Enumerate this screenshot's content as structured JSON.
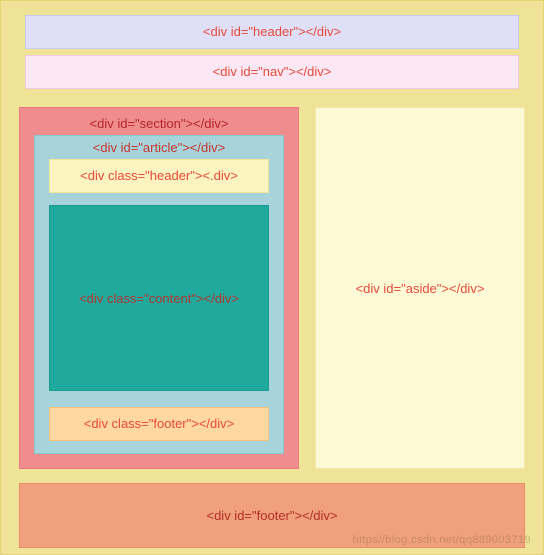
{
  "top": {
    "header_label": "<div id=\"header\"></div>",
    "nav_label": "<div id=\"nav\"></div>"
  },
  "section": {
    "label": "<div id=\"section\"></div>",
    "article": {
      "label": "<div id=\"article\"></div>",
      "header_label": "<div class=\"header\"><.div>",
      "content_label": "<div class=\"content\"></div>",
      "footer_label": "<div class=\"footer\"></div>"
    }
  },
  "aside": {
    "label": "<div id=\"aside\"></div>"
  },
  "footer": {
    "label": "<div id=\"footer\"></div>"
  },
  "watermark": "https//blog.csdn.net/qq889003719"
}
